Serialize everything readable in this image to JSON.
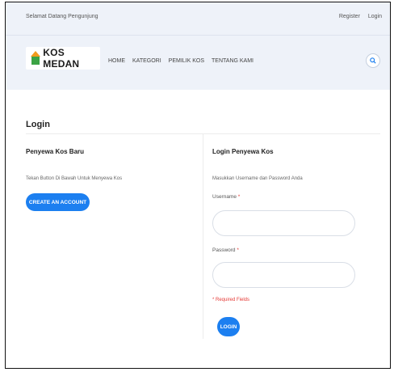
{
  "topbar": {
    "welcome": "Selamat Datang Pengunjung",
    "register": "Register",
    "login": "Login"
  },
  "navbar": {
    "brand": "KOS MEDAN",
    "menu": [
      "HOME",
      "KATEGORI",
      "PEMILIK KOS",
      "TENTANG KAMI"
    ],
    "search_icon": "search-icon"
  },
  "page": {
    "title": "Login"
  },
  "left": {
    "title": "Penyewa Kos Baru",
    "desc": "Tekan Button Di Bawah Untuk Menyewa Kos",
    "create_button": "CREATE AN ACCOUNT"
  },
  "right": {
    "title": "Login Penyewa Kos",
    "desc": "Masukkan Username dan Password Anda",
    "username_label": "Username",
    "password_label": "Password",
    "required_marker": "*",
    "required_note": "* Required Fields",
    "login_button": "LOGIN"
  },
  "colors": {
    "accent": "#1c7ff0",
    "header_bg": "#eef2f9",
    "required": "#e53935"
  }
}
